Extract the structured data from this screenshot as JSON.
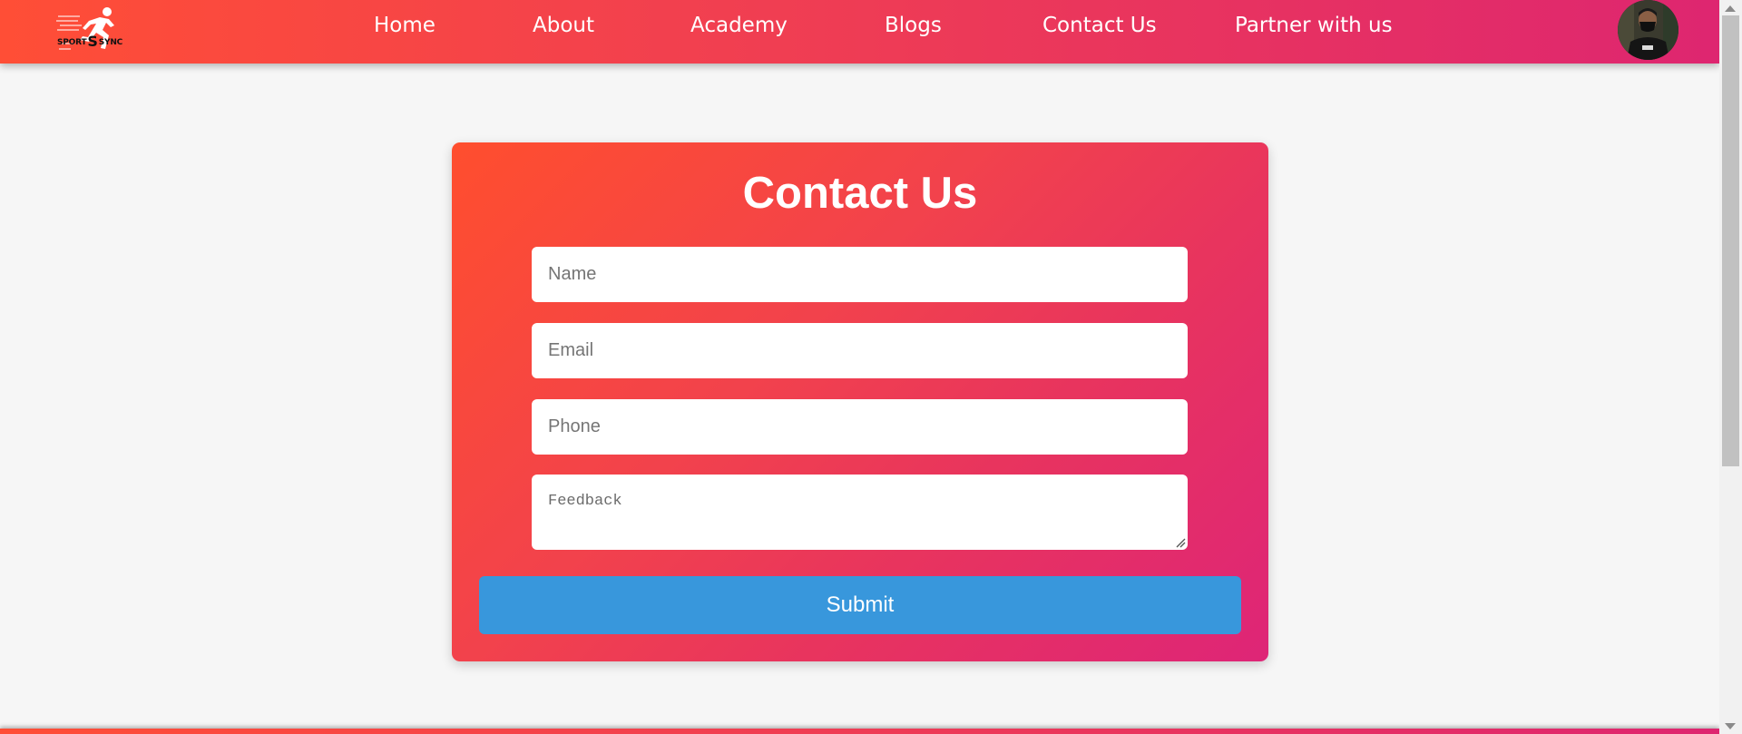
{
  "brand": {
    "logo_text_left": "SPORT",
    "logo_text_mid": "S",
    "logo_text_right": "SYNC"
  },
  "nav": {
    "home": "Home",
    "about": "About",
    "academy": "Academy",
    "blogs": "Blogs",
    "contact": "Contact Us",
    "partner": "Partner with us"
  },
  "contact_form": {
    "title": "Contact Us",
    "name_placeholder": "Name",
    "email_placeholder": "Email",
    "phone_placeholder": "Phone",
    "feedback_placeholder": "Feedback",
    "submit_label": "Submit"
  },
  "colors": {
    "header_gradient_start": "#ff4e36",
    "header_gradient_end": "#de2670",
    "card_gradient_start": "#ff4e2e",
    "card_gradient_end": "#de2577",
    "submit_button": "#3897dc",
    "page_background": "#f6f6f6"
  },
  "icons": {
    "logo": "running-athlete-logo",
    "avatar": "user-avatar",
    "resize": "resize-grip-icon"
  }
}
